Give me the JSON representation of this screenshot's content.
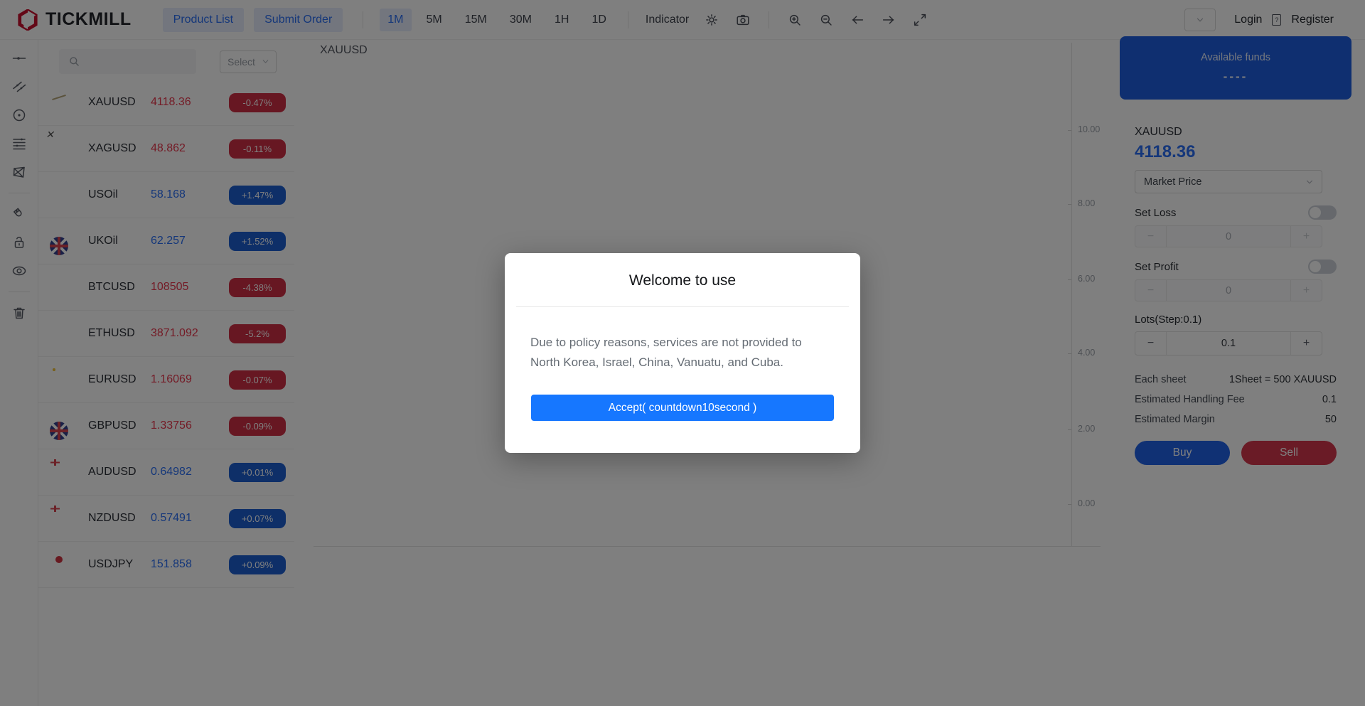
{
  "navbar": {
    "brand": "TICKMILL",
    "product_list_label": "Product List",
    "submit_order_label": "Submit Order",
    "timeframes": [
      "1M",
      "5M",
      "15M",
      "30M",
      "1H",
      "1D"
    ],
    "active_timeframe": "1M",
    "indicator_label": "Indicator",
    "icons": [
      "settings-icon",
      "camera-icon",
      "zoom-in-icon",
      "zoom-out-icon",
      "arrow-left-icon",
      "arrow-right-icon",
      "expand-icon"
    ],
    "login_label": "Login",
    "register_label": "Register"
  },
  "tool_rail_icons": [
    "trendline-icon",
    "parallel-channel-icon",
    "circle-tool-icon",
    "fib-lines-icon",
    "xabcd-pattern-icon",
    "magnet-icon",
    "unlock-icon",
    "eye-icon",
    "trash-icon"
  ],
  "watchlist": {
    "search_icon": "search-icon",
    "select_placeholder": "Select",
    "instruments": [
      {
        "symbol": "XAUUSD",
        "price": "4118.36",
        "change": "-0.47%",
        "direction": "down",
        "front_icon": "gold-coin-icon",
        "back_icon": "us-flag-icon"
      },
      {
        "symbol": "XAGUSD",
        "price": "48.862",
        "change": "-0.11%",
        "direction": "down",
        "front_icon": "silver-coin-icon",
        "back_icon": "us-flag-icon"
      },
      {
        "symbol": "USOil",
        "price": "58.168",
        "change": "+1.47%",
        "direction": "up",
        "front_icon": "us-flag-icon",
        "back_icon": "oil-barrel-icon"
      },
      {
        "symbol": "UKOil",
        "price": "62.257",
        "change": "+1.52%",
        "direction": "up",
        "front_icon": "uk-flag-icon",
        "back_icon": "oil-barrel-icon"
      },
      {
        "symbol": "BTCUSD",
        "price": "108505",
        "change": "-4.38%",
        "direction": "down",
        "front_icon": "bitcoin-icon",
        "back_icon": "us-flag-icon"
      },
      {
        "symbol": "ETHUSD",
        "price": "3871.092",
        "change": "-5.2%",
        "direction": "down",
        "front_icon": "ethereum-icon",
        "back_icon": "us-flag-icon"
      },
      {
        "symbol": "EURUSD",
        "price": "1.16069",
        "change": "-0.07%",
        "direction": "down",
        "front_icon": "eu-flag-icon",
        "back_icon": "us-flag-icon"
      },
      {
        "symbol": "GBPUSD",
        "price": "1.33756",
        "change": "-0.09%",
        "direction": "down",
        "front_icon": "uk-flag-icon",
        "back_icon": "us-flag-icon"
      },
      {
        "symbol": "AUDUSD",
        "price": "0.64982",
        "change": "+0.01%",
        "direction": "up",
        "front_icon": "au-flag-icon",
        "back_icon": "us-flag-icon"
      },
      {
        "symbol": "NZDUSD",
        "price": "0.57491",
        "change": "+0.07%",
        "direction": "up",
        "front_icon": "nz-flag-icon",
        "back_icon": "us-flag-icon"
      },
      {
        "symbol": "USDJPY",
        "price": "151.858",
        "change": "+0.09%",
        "direction": "up",
        "front_icon": "us-flag-icon",
        "back_icon": "jp-flag-icon"
      }
    ]
  },
  "chart": {
    "symbol_label": "XAUUSD",
    "y_ticks": [
      "10.00",
      "8.00",
      "6.00",
      "4.00",
      "2.00",
      "0.00"
    ]
  },
  "trade_panel": {
    "funds_title": "Available funds",
    "funds_value": "----",
    "symbol": "XAUUSD",
    "price": "4118.36",
    "order_type": "Market Price",
    "set_loss_label": "Set Loss",
    "set_loss_value": "0",
    "set_profit_label": "Set Profit",
    "set_profit_value": "0",
    "lots_label": "Lots(Step:0.1)",
    "lots_value": "0.1",
    "minus_label": "−",
    "plus_label": "+",
    "each_sheet_label": "Each sheet",
    "each_sheet_value": "1Sheet = 500 XAUUSD",
    "fee_label": "Estimated Handling Fee",
    "fee_value": "0.1",
    "margin_label": "Estimated Margin",
    "margin_value": "50",
    "buy_label": "Buy",
    "sell_label": "Sell"
  },
  "modal": {
    "title": "Welcome to use",
    "body": "Due to policy reasons, services are not provided to North Korea, Israel, China, Vanuatu, and Cuba.",
    "accept_label": "Accept( countdown10second )"
  },
  "colors": {
    "accent_blue": "#2a6ff5",
    "accent_red": "#e8364d",
    "badge_up_blue": "#1d5fd0",
    "badge_down_red": "#cf2f44",
    "funds_card_blue": "#1e5fe0",
    "buy_blue": "#2163e8",
    "sell_red": "#d4374d",
    "accept_blue": "#1677ff",
    "brand_red": "#c8102e"
  }
}
